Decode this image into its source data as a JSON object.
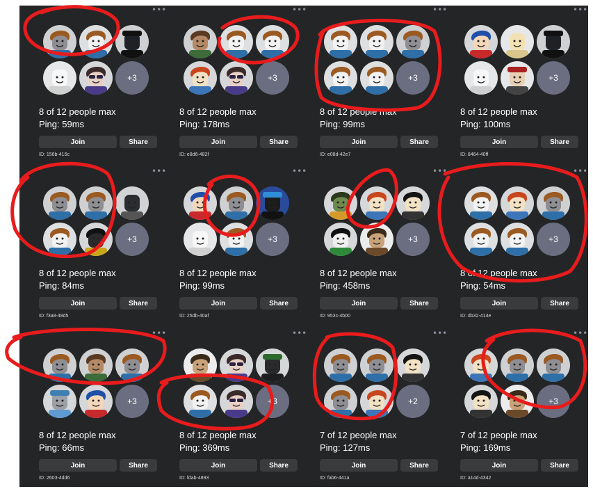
{
  "labels": {
    "join": "Join",
    "share": "Share"
  },
  "servers": [
    {
      "players": "8 of 12 people max",
      "ping": "Ping: 59ms",
      "id": "ID: 156b-416c",
      "more": "+3",
      "avatars": [
        "bacon-gray",
        "bacon-white",
        "black-hat",
        "classic-white",
        "sunglasses"
      ]
    },
    {
      "players": "8 of 12 people max",
      "ping": "Ping: 178ms",
      "id": "ID: e8d6-482f",
      "more": "+3",
      "avatars": [
        "tan-face",
        "bacon-white",
        "bacon-white",
        "red-hair",
        "sunglasses"
      ]
    },
    {
      "players": "8 of 12 people max",
      "ping": "Ping: 99ms",
      "id": "ID: e08d-42e7",
      "more": "+3",
      "avatars": [
        "bacon-white",
        "bacon-white",
        "bacon-gray",
        "bacon-white",
        "bacon-white"
      ]
    },
    {
      "players": "8 of 12 people max",
      "ping": "Ping: 100ms",
      "id": "ID: 8464-40ff",
      "more": "+3",
      "avatars": [
        "blue-hair",
        "classic-yellow",
        "black-hat",
        "classic-white",
        "cap-figure"
      ]
    },
    {
      "players": "8 of 12 people max",
      "ping": "Ping: 84ms",
      "id": "ID: f3a8-48d5",
      "more": "+3",
      "avatars": [
        "bacon-gray",
        "bacon-gray",
        "robot",
        "bacon-white",
        "dark-figure"
      ]
    },
    {
      "players": "8 of 12 people max",
      "ping": "Ping: 99ms",
      "id": "ID: 25db-40af",
      "more": "+3",
      "avatars": [
        "blue-hair",
        "bacon-gray",
        "robot-blue",
        "classic-white",
        "bacon-white"
      ]
    },
    {
      "players": "8 of 12 people max",
      "ping": "Ping: 458ms",
      "id": "ID: 953c-4b00",
      "more": "+3",
      "avatars": [
        "green-figure",
        "red-hair",
        "black-hair",
        "green-shirt",
        "small-figure"
      ]
    },
    {
      "players": "8 of 12 people max",
      "ping": "Ping: 54ms",
      "id": "ID: db32-414e",
      "more": "+3",
      "avatars": [
        "bacon-white",
        "red-hair",
        "bacon-gray",
        "bacon-white",
        "bacon-white"
      ]
    },
    {
      "players": "8 of 12 people max",
      "ping": "Ping: 66ms",
      "id": "ID: 2603-4dd6",
      "more": "+3",
      "avatars": [
        "bacon-gray",
        "tan-face",
        "bacon-gray",
        "blue-hat",
        "blue-hair"
      ]
    },
    {
      "players": "8 of 12 people max",
      "ping": "Ping: 369ms",
      "id": "ID: fdab-4893",
      "more": "+3",
      "avatars": [
        "small-figure",
        "sunglasses",
        "green-hat",
        "bacon-white",
        "sunglasses"
      ]
    },
    {
      "players": "7 of 12 people max",
      "ping": "Ping: 127ms",
      "id": "ID: fab6-441a",
      "more": "+2",
      "avatars": [
        "bacon-gray",
        "bacon-gray",
        "black-hair",
        "bacon-gray",
        "red-hair"
      ]
    },
    {
      "players": "7 of 12 people max",
      "ping": "Ping: 169ms",
      "id": "ID: a14d-4342",
      "more": "+3",
      "avatars": [
        "red-hair",
        "bacon-gray",
        "bacon-gray",
        "black-hair",
        "small-figure"
      ]
    }
  ]
}
